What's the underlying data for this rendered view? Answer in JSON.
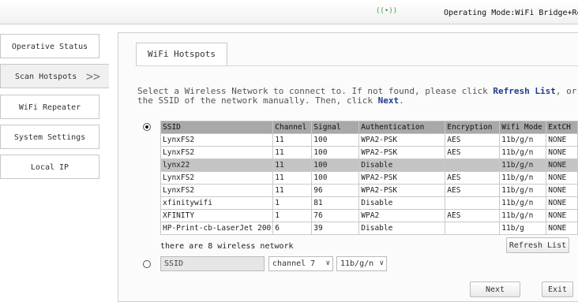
{
  "header": {
    "signal_icon_text": "((•))",
    "mode_label": "Operating Mode:",
    "mode_value": "WiFi Bridge+Rep"
  },
  "sidebar": {
    "items": [
      {
        "label": "Operative Status"
      },
      {
        "label": "Scan Hotspots",
        "arrow": ">>"
      },
      {
        "label": "WiFi Repeater"
      },
      {
        "label": "System Settings"
      },
      {
        "label": "Local IP"
      }
    ]
  },
  "tab": {
    "label": "WiFi Hotspots"
  },
  "instructions": {
    "part1": "Select a Wireless Network to connect to. If not found, please click ",
    "link1": "Refresh List",
    "part2": ", or ente",
    "part3": "the SSID of the network manually. Then, click ",
    "link2": "Next",
    "part4": "."
  },
  "table": {
    "headers": [
      "SSID",
      "Channel",
      "Signal",
      "Authentication",
      "Encryption",
      "Wifi Mode",
      "ExtCH"
    ],
    "rows": [
      [
        "LynxFS2",
        "11",
        "100",
        "WPA2-PSK",
        "AES",
        "11b/g/n",
        "NONE"
      ],
      [
        "LynxFS2",
        "11",
        "100",
        "WPA2-PSK",
        "AES",
        "11b/g/n",
        "NONE"
      ],
      [
        "lynx22",
        "11",
        "100",
        "Disable",
        "",
        "11b/g/n",
        "NONE"
      ],
      [
        "LynxFS2",
        "11",
        "100",
        "WPA2-PSK",
        "AES",
        "11b/g/n",
        "NONE"
      ],
      [
        "LynxFS2",
        "11",
        "96",
        "WPA2-PSK",
        "AES",
        "11b/g/n",
        "NONE"
      ],
      [
        "xfinitywifi",
        "1",
        "81",
        "Disable",
        "",
        "11b/g/n",
        "NONE"
      ],
      [
        "XFINITY",
        "1",
        "76",
        "WPA2",
        "AES",
        "11b/g/n",
        "NONE"
      ],
      [
        "HP-Print-cb-LaserJet 200",
        "6",
        "39",
        "Disable",
        "",
        "11b/g",
        "NONE"
      ]
    ],
    "selected_row": 2
  },
  "count_text": "there are 8 wireless network",
  "refresh_label": "Refresh List",
  "manual": {
    "ssid_placeholder": "SSID",
    "channel_value": "channel 7",
    "mode_value": "11b/g/n"
  },
  "buttons": {
    "next": "Next",
    "exit": "Exit"
  }
}
